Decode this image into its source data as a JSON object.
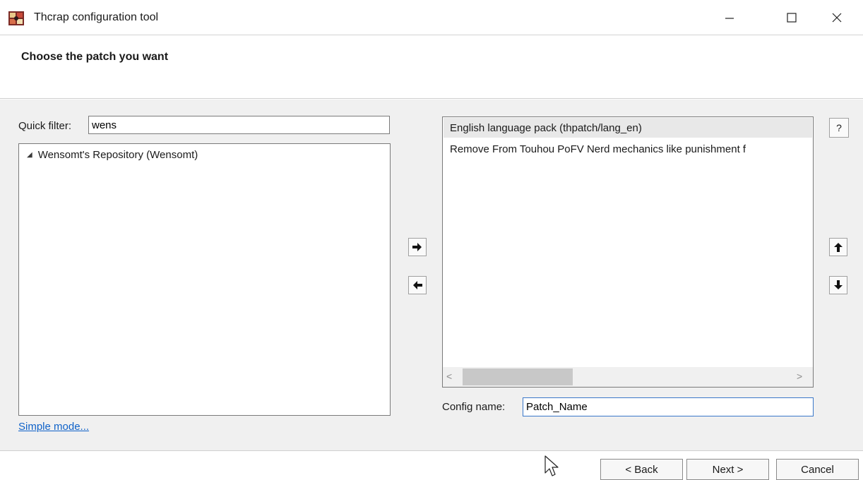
{
  "window": {
    "title": "Thcrap configuration tool",
    "icon": "thcrap-app-icon",
    "controls": [
      "minimize-icon",
      "maximize-icon",
      "close-icon"
    ]
  },
  "header": {
    "heading": "Choose the patch you want"
  },
  "left": {
    "filter_label": "Quick filter:",
    "filter_value": "wens",
    "tree": [
      {
        "label": "Wensomt's Repository (Wensomt)",
        "expanded": true,
        "expander_icon": "expand-triangle-icon"
      }
    ],
    "simple_mode_link": "Simple mode..."
  },
  "transfer_buttons": [
    "arrow-right-icon",
    "arrow-left-icon"
  ],
  "right": {
    "selected_patches": [
      "English language pack (thpatch/lang_en)",
      "Remove From Touhou PoFV Nerd mechanics like punishment f"
    ],
    "help_label": "?",
    "order_buttons": [
      "arrow-up-icon",
      "arrow-down-icon"
    ],
    "scroll_arrows": {
      "left": "<",
      "right": ">"
    },
    "config_label": "Config name:",
    "config_value": "Patch_Name"
  },
  "footer": {
    "back_label": "< Back",
    "next_label": "Next >",
    "cancel_label": "Cancel"
  },
  "colors": {
    "link": "#0f62c9",
    "focus_border": "#3a78c9",
    "panel_bg": "#f0f0f0",
    "selected_row_bg": "#e8e8e8"
  }
}
